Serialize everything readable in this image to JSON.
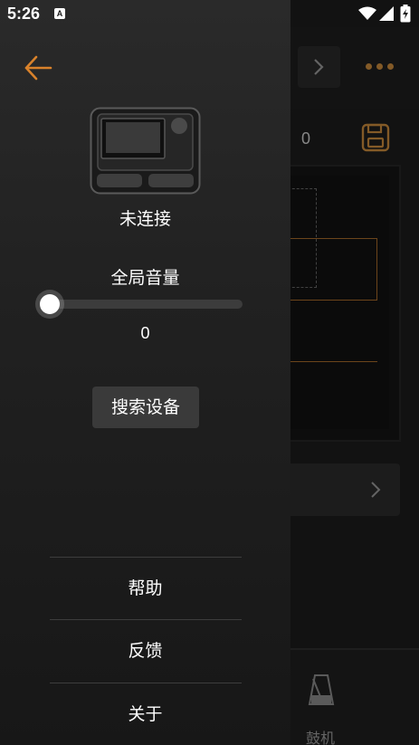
{
  "status_bar": {
    "time": "5:26",
    "notification_icon_letter": "A",
    "icons": [
      "wifi-icon",
      "signal-icon",
      "battery-charging-icon"
    ]
  },
  "drawer": {
    "back_icon": "arrow-left-icon",
    "device_image": "drum-module-device-icon",
    "connection_status": "未连接",
    "global_volume_label": "全局音量",
    "volume_value": "0",
    "volume_slider_level": 0,
    "search_button_label": "搜索设备",
    "menu": [
      {
        "label": "帮助"
      },
      {
        "label": "反馈"
      },
      {
        "label": "关于"
      }
    ]
  },
  "background_app": {
    "counter_value": "0",
    "bottom_tab_label": "鼓机",
    "bottom_tab_icon": "metronome-icon"
  },
  "colors": {
    "accent": "#d9822b",
    "drawer_bg": "#262626",
    "button_bg": "#3a3a3a"
  }
}
